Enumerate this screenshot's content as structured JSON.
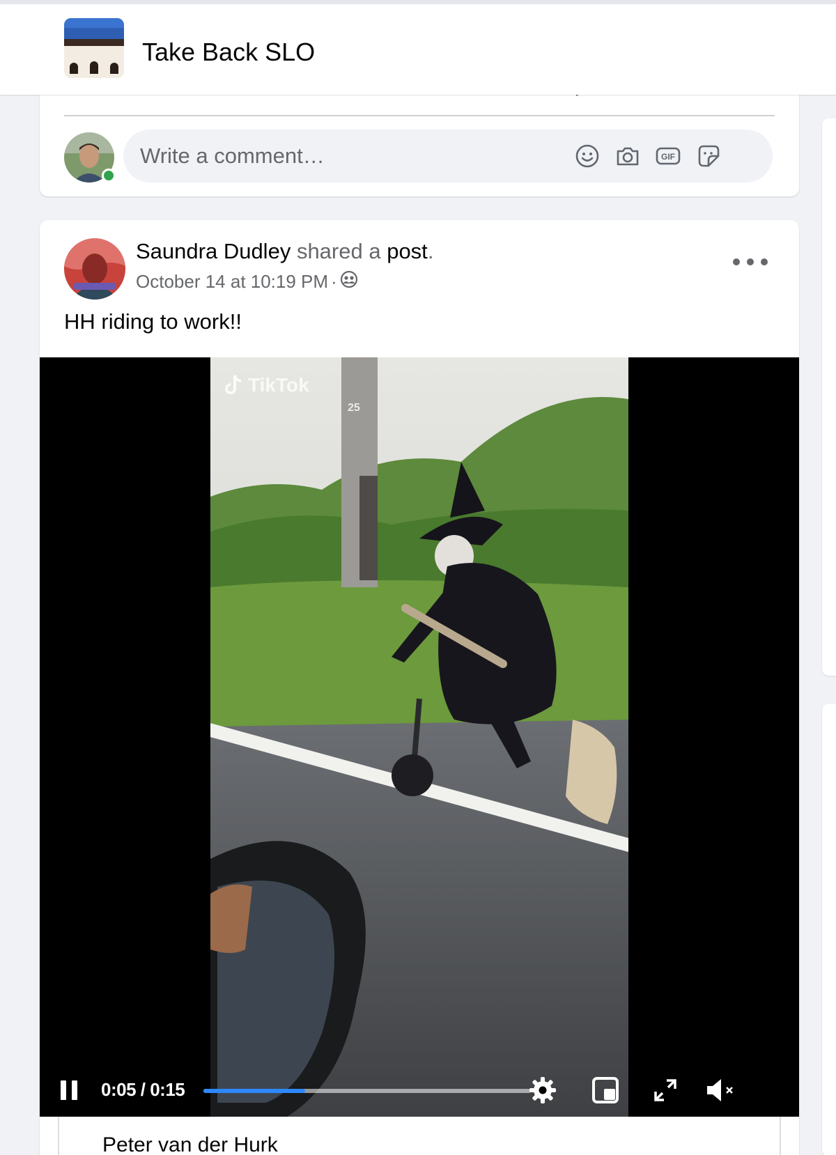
{
  "group": {
    "name": "Take Back SLO"
  },
  "comment_box": {
    "placeholder": "Write a comment…",
    "icons": [
      "emoji-icon",
      "camera-icon",
      "gif-icon",
      "sticker-icon"
    ]
  },
  "post": {
    "author": "Saundra Dudley",
    "action_prefix": " shared a ",
    "action_object": "post",
    "action_suffix": ".",
    "timestamp": "October 14 at 10:19 PM",
    "separator": "·",
    "audience_icon": "group-audience-icon",
    "text": "HH riding to work!!"
  },
  "video": {
    "watermark": "TikTok",
    "watermark_number": "25",
    "current_time": "0:05",
    "duration": "0:15",
    "time_display": "0:05 / 0:15",
    "progress_fraction": 0.31,
    "buffered_fraction": 1.0,
    "accent_color": "#2d88ff",
    "state": "playing",
    "muted": true
  },
  "next_comment": {
    "author": "Peter van der Hurk"
  }
}
